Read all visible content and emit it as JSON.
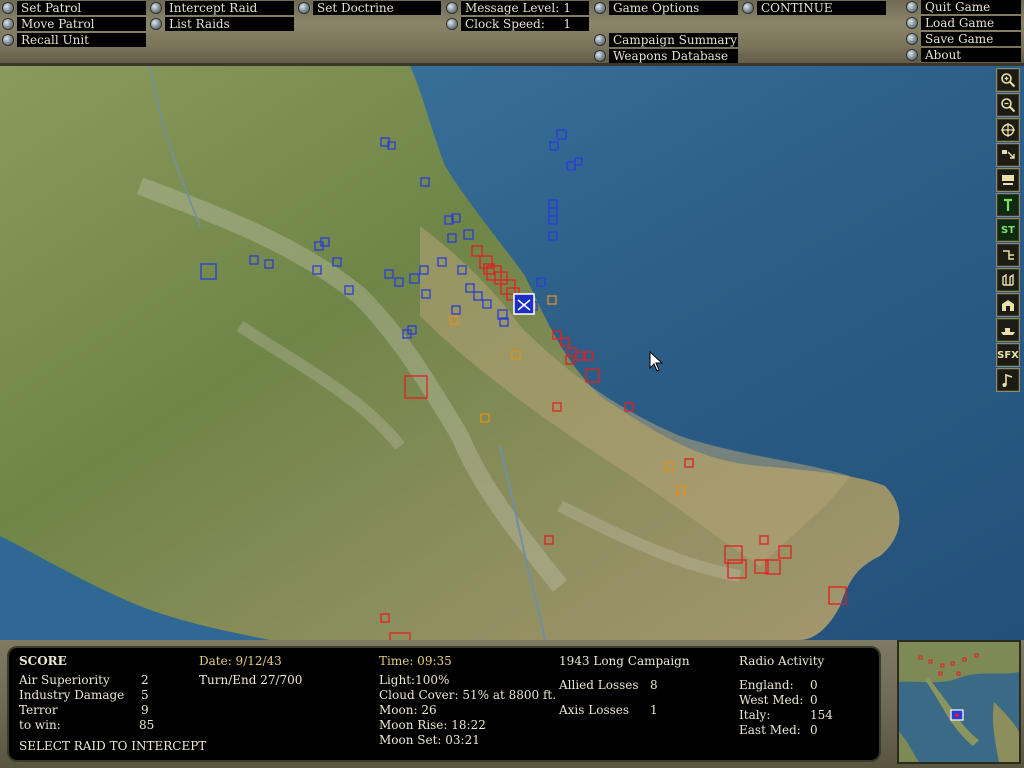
{
  "menu": {
    "set_patrol": "Set Patrol",
    "move_patrol": "Move Patrol",
    "recall_unit": "Recall Unit",
    "intercept_raid": "Intercept Raid",
    "list_raids": "List Raids",
    "set_doctrine": "Set Doctrine",
    "message_level_label": "Message Level:",
    "message_level_value": "1",
    "clock_speed_label": "Clock Speed:",
    "clock_speed_value": "1",
    "game_options": "Game Options",
    "continue": "CONTINUE",
    "campaign_summary": "Campaign Summary",
    "weapons_database": "Weapons Database",
    "quit_game": "Quit Game",
    "load_game": "Load Game",
    "save_game": "Save Game",
    "about": "About"
  },
  "toolbar": {
    "st_label": "ST",
    "sfx_label": "SFX",
    "icons": [
      "zoom-in-icon",
      "zoom-out-icon",
      "center-icon",
      "grid-icon",
      "airbase-icon",
      "flag-icon",
      "st",
      "rail-icon",
      "fort-icon",
      "factory-icon",
      "ship-icon",
      "sfx",
      "music-icon"
    ]
  },
  "status": {
    "score_title": "SCORE",
    "air_superiority_label": "Air Superiority",
    "air_superiority_value": "2",
    "industry_damage_label": "Industry Damage",
    "industry_damage_value": "5",
    "terror_label": "Terror",
    "terror_value": "9",
    "to_win_label": "to win:",
    "to_win_value": "85",
    "prompt": "SELECT RAID TO INTERCEPT",
    "date": "Date: 9/12/43",
    "turn_end": "Turn/End  27/700",
    "time": "Time: 09:35",
    "light": "Light:100%",
    "cloud_cover": "Cloud Cover: 51% at 8800 ft.",
    "moon": "Moon: 26",
    "moon_rise": "Moon Rise: 18:22",
    "moon_set": "Moon Set: 03:21",
    "campaign": "1943 Long Campaign",
    "allied_losses_label": "Allied Losses",
    "allied_losses_value": "8",
    "axis_losses_label": "Axis Losses",
    "axis_losses_value": "1",
    "radio_title": "Radio Activity",
    "radio": [
      {
        "region": "England:",
        "value": "0"
      },
      {
        "region": "West Med:",
        "value": "0"
      },
      {
        "region": "Italy:",
        "value": "154"
      },
      {
        "region": "East Med:",
        "value": "0"
      }
    ]
  },
  "colors": {
    "allied_units": "#2a3cd8",
    "axis_units": "#e02020",
    "neutral_units": "#e09018",
    "sea": "#2f5f86",
    "land": "#7d8f52"
  }
}
